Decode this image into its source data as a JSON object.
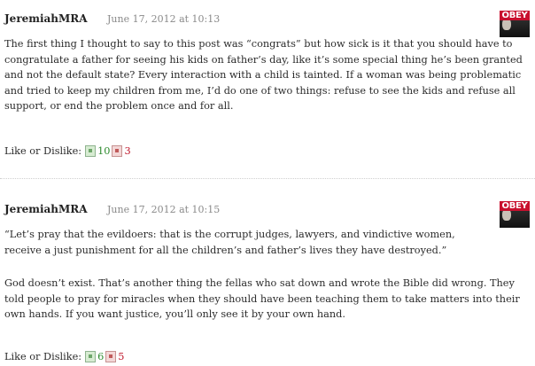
{
  "comments": [
    {
      "author": "JeremiahMRA",
      "date": "June 17, 2012 at 10:13",
      "avatar_text": "OBEY",
      "paragraphs": [
        "The first thing I thought to say to this post was “congrats” but how sick is it that you should have to congratulate a father for seeing his kids on father’s day, like it’s some special thing he’s been granted and not the default state? Every interaction with a child is tainted. If a woman was being problematic and tried to keep my children from me, I’d do one of two things: refuse to see the kids and refuse all support, or end the problem once and for all."
      ],
      "vote_label": "Like or Dislike:",
      "likes": "10",
      "dislikes": "3"
    },
    {
      "author": "JeremiahMRA",
      "date": "June 17, 2012 at 10:15",
      "avatar_text": "OBEY",
      "paragraphs": [
        "“Let’s pray that the evildoers: that is the corrupt judges, lawyers, and vindictive women, receive a just punishment for all the children’s and father’s lives they have destroyed.”",
        "God doesn’t exist. That’s another thing the fellas who sat down and wrote the Bible did wrong. They told people to pray for miracles when they should have been teaching them to take matters into their own hands. If you want justice, you’ll only see it by your own hand."
      ],
      "vote_label": "Like or Dislike:",
      "likes": "6",
      "dislikes": "5"
    }
  ],
  "colors": {
    "likes": "#2e8b2e",
    "dislikes": "#c0182c",
    "date": "#8a8a8a"
  }
}
